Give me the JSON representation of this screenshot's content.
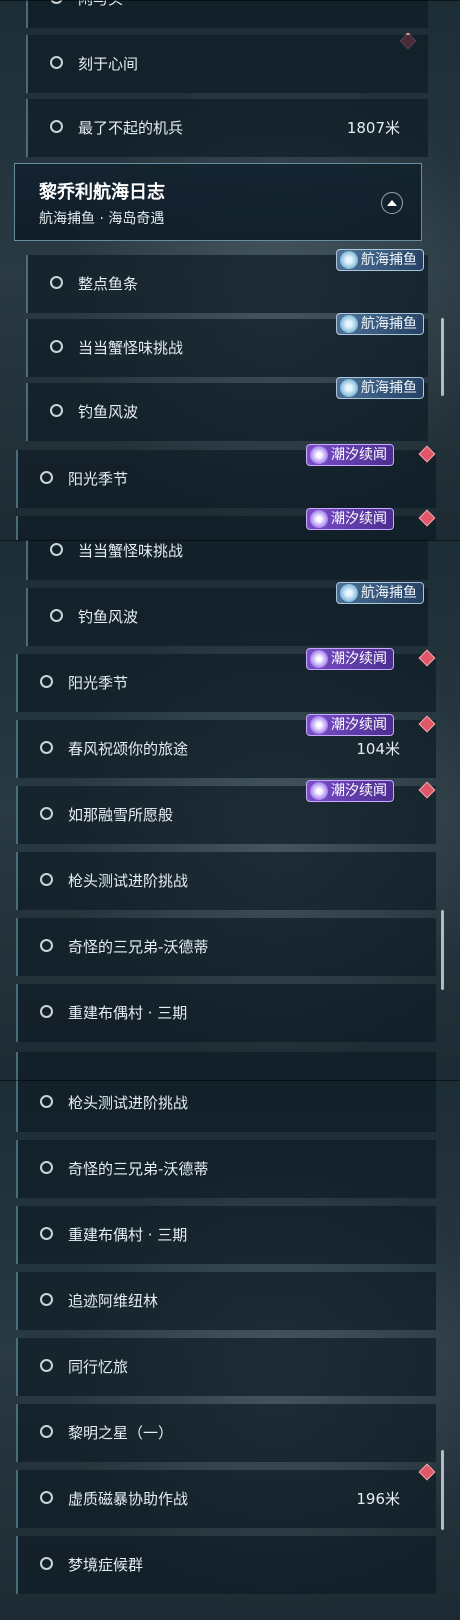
{
  "panel1": {
    "top_clipped_label": "闲与头",
    "rows_before": [
      {
        "label": "刻于心间",
        "distance": ""
      },
      {
        "label": "最了不起的机兵",
        "distance": "1807米"
      }
    ],
    "group": {
      "title": "黎乔利航海日志",
      "subtitle": "航海捕鱼 · 海岛奇遇"
    },
    "rows_after": [
      {
        "label": "整点鱼条",
        "badge": "航海捕鱼"
      },
      {
        "label": "当当蟹怪味挑战",
        "badge": "航海捕鱼"
      },
      {
        "label": "钓鱼风波",
        "badge": "航海捕鱼"
      },
      {
        "label": "阳光季节",
        "badge": "潮汐续闻"
      }
    ],
    "bottom_clipped_badge": "潮汐续闻"
  },
  "panel2": {
    "rows": [
      {
        "label": "当当蟹怪味挑战",
        "distance": "",
        "badge": ""
      },
      {
        "label": "钓鱼风波",
        "distance": "",
        "badge": "航海捕鱼"
      },
      {
        "label": "阳光季节",
        "distance": "",
        "badge": "潮汐续闻"
      },
      {
        "label": "春风祝颂你的旅途",
        "distance": "104米",
        "badge": "潮汐续闻"
      },
      {
        "label": "如那融雪所愿般",
        "distance": "",
        "badge": "潮汐续闻"
      },
      {
        "label": "枪头测试进阶挑战",
        "distance": "",
        "badge": ""
      },
      {
        "label": "奇怪的三兄弟-沃德蒂",
        "distance": "",
        "badge": ""
      },
      {
        "label": "重建布偶村 · 三期",
        "distance": "",
        "badge": ""
      }
    ]
  },
  "panel3": {
    "rows": [
      {
        "label": "枪头测试进阶挑战",
        "distance": ""
      },
      {
        "label": "奇怪的三兄弟-沃德蒂",
        "distance": ""
      },
      {
        "label": "重建布偶村 · 三期",
        "distance": ""
      },
      {
        "label": "追迹阿维纽林",
        "distance": ""
      },
      {
        "label": "同行忆旅",
        "distance": ""
      },
      {
        "label": "黎明之星（一）",
        "distance": ""
      },
      {
        "label": "虚质磁暴协助作战",
        "distance": "196米"
      },
      {
        "label": "梦境症候群",
        "distance": ""
      }
    ]
  },
  "colors": {
    "tracked_diamond": "#e05868",
    "badge_fishing": "#5a88b5",
    "badge_tide": "#7a4fc8"
  },
  "icons": {
    "row_status": "circle-outline-icon",
    "tracked": "diamond-marker-icon",
    "fishing_badge": "wave-icon",
    "tide_badge": "star-sparkle-icon"
  }
}
